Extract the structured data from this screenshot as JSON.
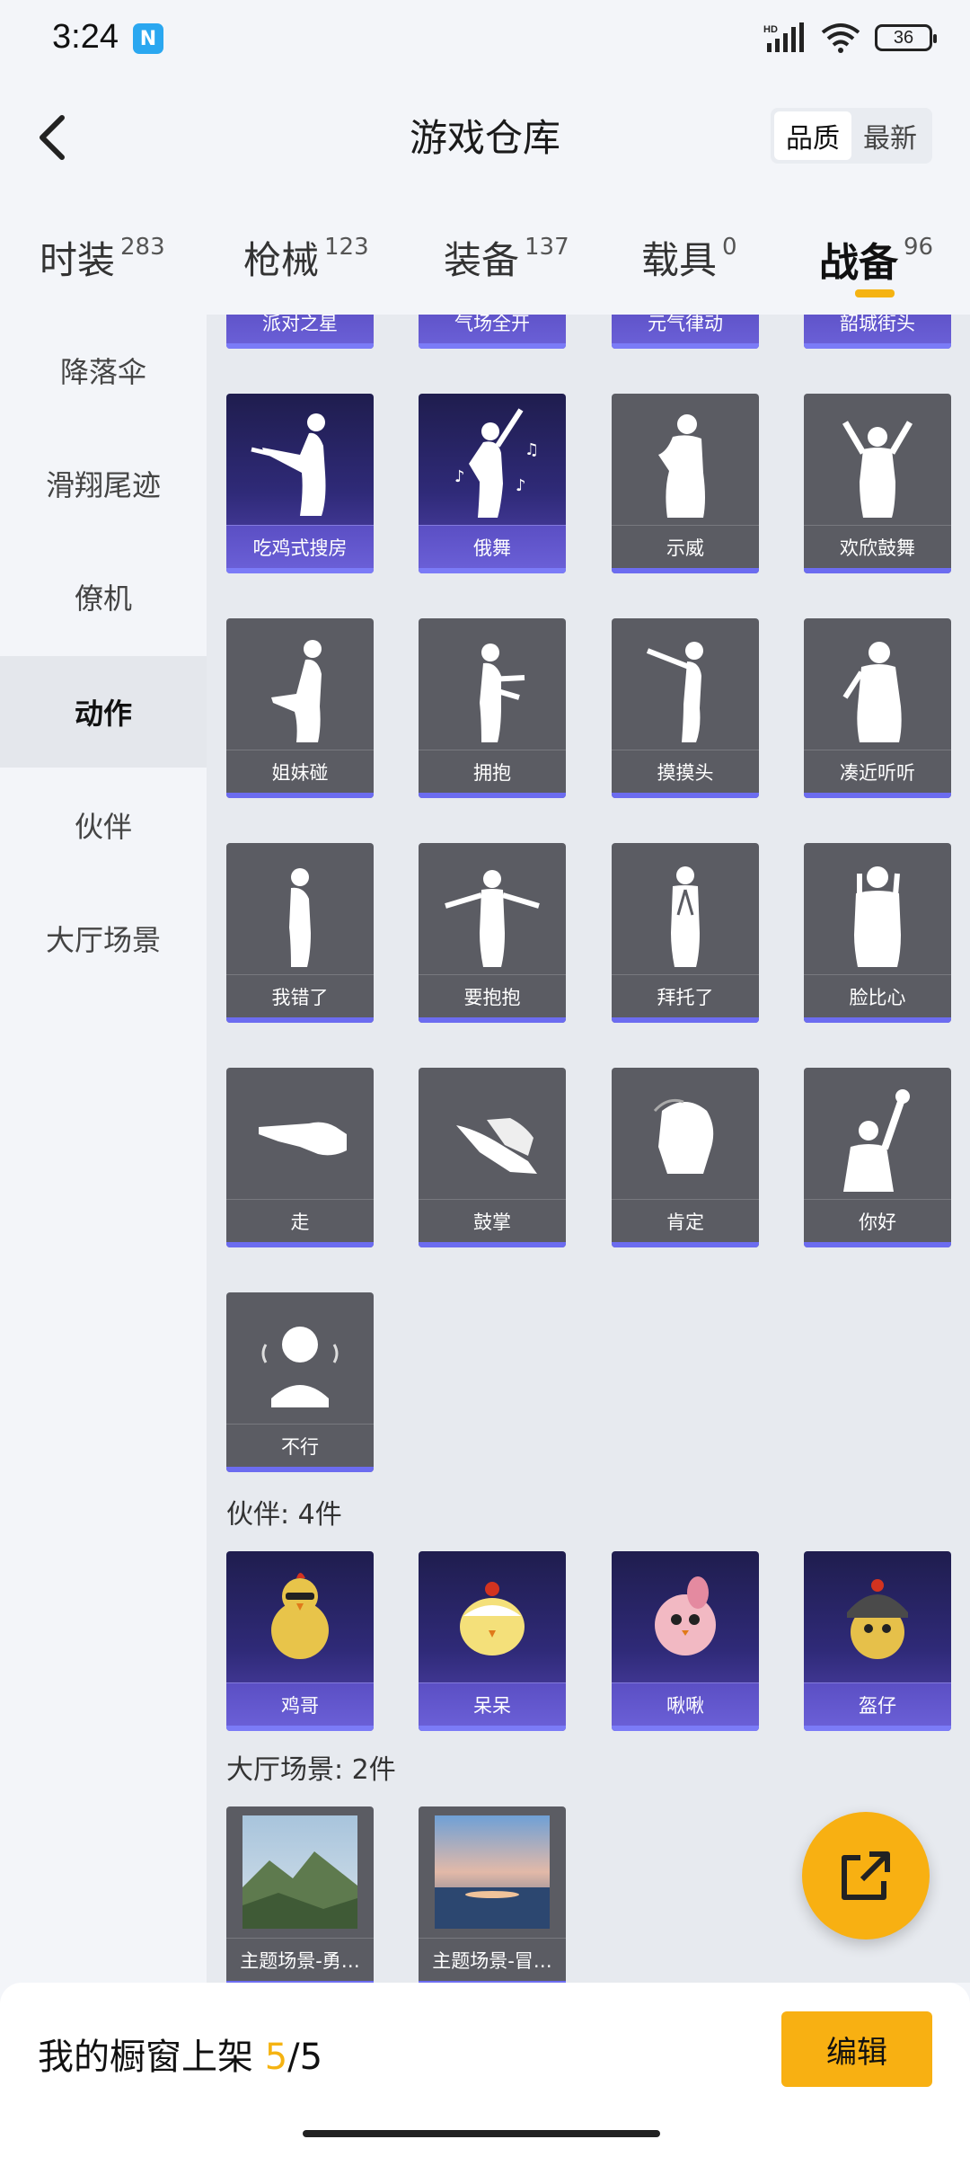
{
  "status": {
    "time": "3:24",
    "battery": "36"
  },
  "header": {
    "title": "游戏仓库",
    "sort_options": [
      "品质",
      "最新"
    ]
  },
  "tabs": [
    {
      "label": "时装",
      "count": "283"
    },
    {
      "label": "枪械",
      "count": "123"
    },
    {
      "label": "装备",
      "count": "137"
    },
    {
      "label": "载具",
      "count": "0"
    },
    {
      "label": "战备",
      "count": "96"
    }
  ],
  "sidebar": {
    "items": [
      "降落伞",
      "滑翔尾迹",
      "僚机",
      "动作",
      "伙伴",
      "大厅场景"
    ]
  },
  "top_partial_row": [
    "派对之星",
    "气场全开",
    "元气律动",
    "韶城街头"
  ],
  "actions": [
    "吃鸡式搜房",
    "俄舞",
    "示威",
    "欢欣鼓舞",
    "姐妹碰",
    "拥抱",
    "摸摸头",
    "凑近听听",
    "我错了",
    "要抱抱",
    "拜托了",
    "脸比心",
    "走",
    "鼓掌",
    "肯定",
    "你好",
    "不行"
  ],
  "partners_section": {
    "title": "伙伴: 4件",
    "items": [
      "鸡哥",
      "呆呆",
      "啾啾",
      "盔仔"
    ]
  },
  "lobby_section": {
    "title": "大厅场景: 2件",
    "items": [
      "主题场景-勇…",
      "主题场景-冒…"
    ]
  },
  "bottom": {
    "showcase_prefix": "我的橱窗上架 ",
    "showcase_current": "5",
    "showcase_total": "/5",
    "edit_label": "编辑"
  },
  "colors": {
    "accent": "#f8b012",
    "purple_card": "#2f2a78",
    "gray_card": "#5b5c63"
  }
}
